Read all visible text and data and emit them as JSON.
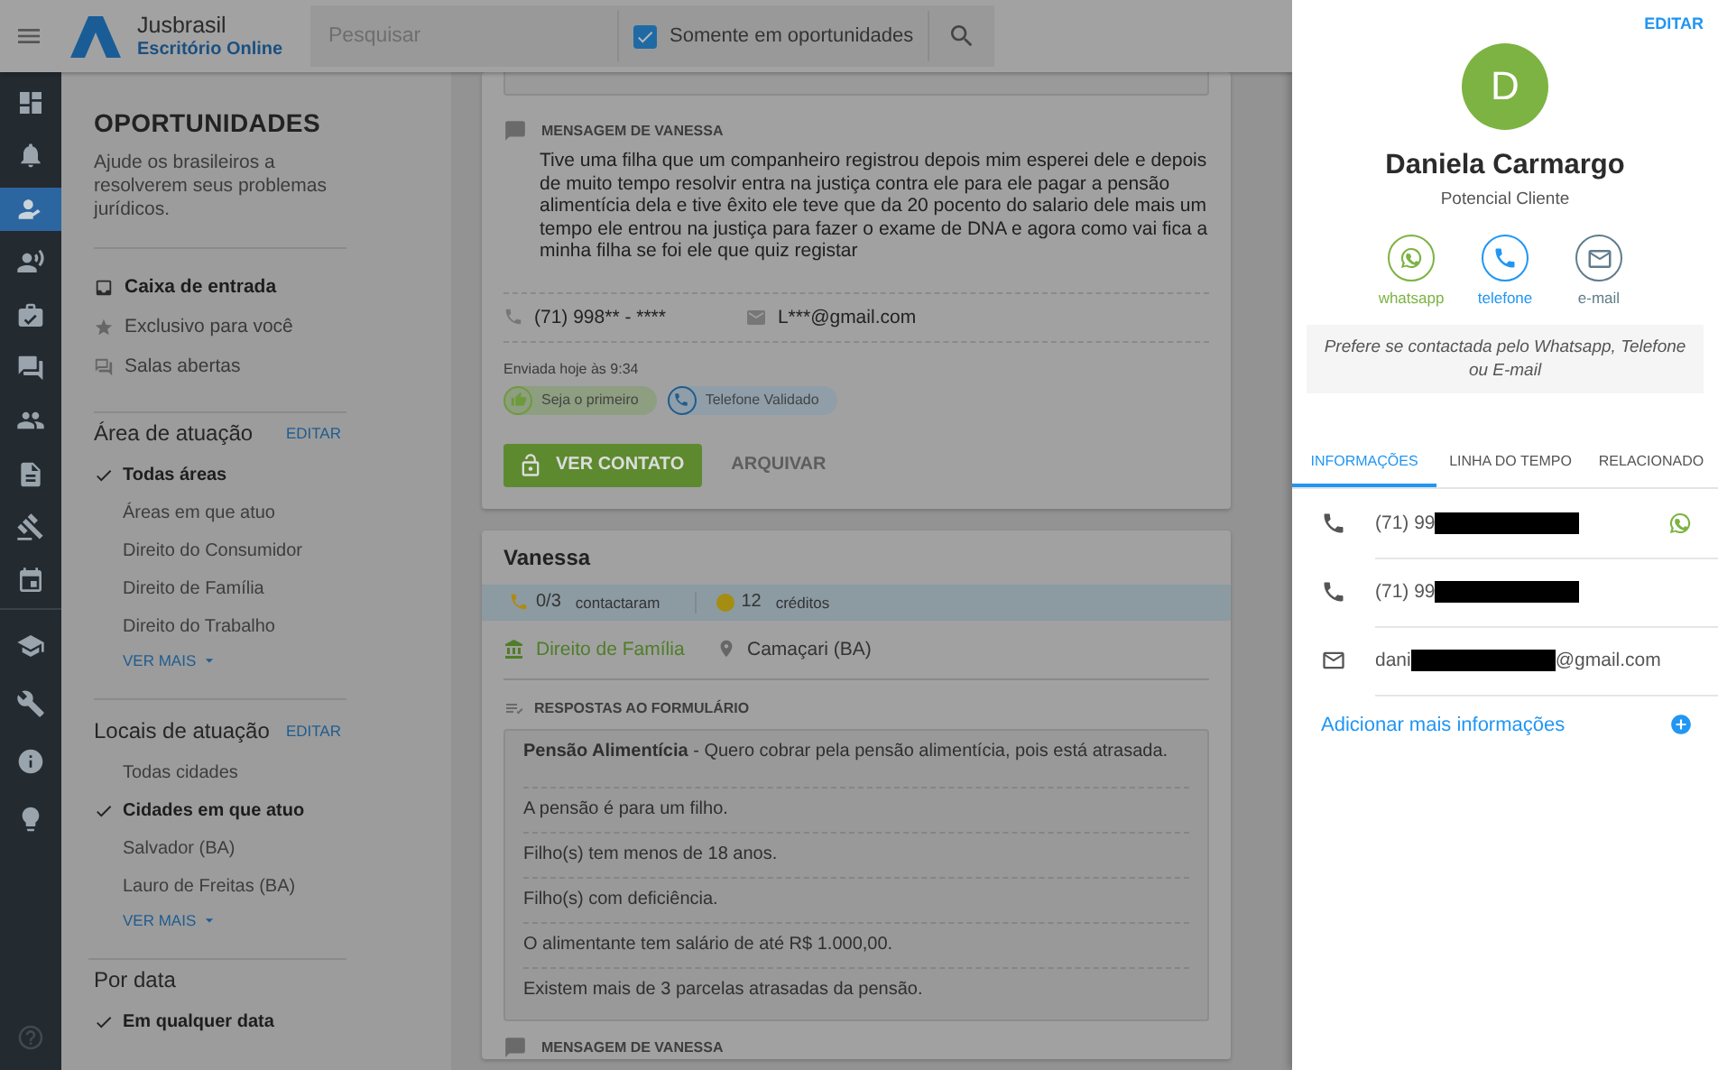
{
  "header": {
    "logo": {
      "name": "Jusbrasil",
      "subtitle": "Escritório Online"
    },
    "search": {
      "placeholder": "Pesquisar"
    },
    "filter": {
      "label": "Somente em oportunidades",
      "checked": true
    }
  },
  "rail": {
    "items": [
      {
        "kind": "dashboard",
        "selected": false
      },
      {
        "kind": "bell",
        "selected": false
      },
      {
        "kind": "person",
        "selected": true
      },
      {
        "kind": "speaker",
        "selected": false
      },
      {
        "kind": "briefcase",
        "selected": false
      },
      {
        "kind": "chat",
        "selected": false
      },
      {
        "kind": "group",
        "selected": false
      },
      {
        "kind": "document",
        "selected": false
      },
      {
        "kind": "gavel",
        "selected": false
      },
      {
        "kind": "calendar",
        "selected": false
      }
    ],
    "bottom_items": [
      {
        "kind": "school",
        "selected": false
      },
      {
        "kind": "wrench",
        "selected": false
      },
      {
        "kind": "info",
        "selected": false
      },
      {
        "kind": "bulb",
        "selected": false
      }
    ]
  },
  "sidebar": {
    "title": "OPORTUNIDADES",
    "description": "Ajude os brasileiros a resolverem seus problemas jurídicos.",
    "nav": [
      {
        "kind": "inbox",
        "label": "Caixa de entrada",
        "selected": true
      },
      {
        "kind": "star",
        "label": "Exclusivo para você",
        "selected": false
      },
      {
        "kind": "rooms",
        "label": "Salas abertas",
        "selected": false
      }
    ],
    "filters": [
      {
        "title": "Área de atuação",
        "edit": "EDITAR",
        "more": "VER MAIS",
        "options": [
          {
            "label": "Todas áreas",
            "checked": true
          },
          {
            "label": "Áreas em que atuo",
            "checked": false
          },
          {
            "label": "Direito do Consumidor",
            "checked": false
          },
          {
            "label": "Direito de Família",
            "checked": false
          },
          {
            "label": "Direito do Trabalho",
            "checked": false
          }
        ]
      },
      {
        "title": "Locais de atuação",
        "edit": "EDITAR",
        "more": "VER MAIS",
        "options": [
          {
            "label": "Todas cidades",
            "checked": false
          },
          {
            "label": "Cidades em que atuo",
            "checked": true
          },
          {
            "label": "Salvador (BA)",
            "checked": false
          },
          {
            "label": "Lauro de Freitas (BA)",
            "checked": false
          }
        ]
      },
      {
        "title": "Por data",
        "options": [
          {
            "label": "Em qualquer data",
            "checked": true
          }
        ]
      }
    ]
  },
  "lead_card": {
    "message_title": "MENSAGEM DE VANESSA",
    "message": "Tive uma filha que um companheiro registrou depois mim esperei dele e depois de muito tempo resolvir entra na justiça contra ele para ele pagar a pensão alimentícia dela e tive êxito ele teve que da 20 pocento do salario dele mais um tempo ele entrou na justiça para fazer o exame de DNA e agora como vai fica a minha filha se foi ele que quiz registar",
    "phone": "(71) 998** - ****",
    "email": "L***@gmail.com",
    "sent": "Enviada hoje às 9:34",
    "badges": [
      {
        "kind": "thumb",
        "label": "Seja o primeiro"
      },
      {
        "kind": "phone",
        "label": "Telefone Validado"
      }
    ],
    "primary_action": "VER CONTATO",
    "secondary_action": "ARQUIVAR"
  },
  "detail_card": {
    "name": "Vanessa",
    "contacted": "0/3",
    "contacted_label": "contactaram",
    "credits": "12",
    "credits_label": "créditos",
    "area": "Direito de Família",
    "location": "Camaçari (BA)",
    "form_title": "RESPOSTAS AO FORMULÁRIO",
    "form_lead": "**Pensão Alimentícia** - Quero cobrar pela pensão alimentícia, pois está atrasada.",
    "answers": [
      "A pensão é para um filho.",
      "Filho(s) tem menos de 18 anos.",
      "Filho(s) com deficiência.",
      "O alimentante tem salário de até R$ 1.000,00.",
      "Existem mais de 3 parcelas atrasadas da pensão."
    ],
    "message_title": "MENSAGEM DE VANESSA"
  },
  "drawer": {
    "edit": "EDITAR",
    "initial": "D",
    "name": "Daniela Carmargo",
    "role": "Potencial Cliente",
    "actions": [
      {
        "kind": "whatsapp",
        "label": "whatsapp",
        "color": "#7cb342"
      },
      {
        "kind": "phone",
        "label": "telefone",
        "color": "#2196f3"
      },
      {
        "kind": "email",
        "label": "e-mail",
        "color": "#607d8b"
      }
    ],
    "preference": "Prefere se contactada pelo Whatsapp, Telefone ou E-mail",
    "tabs": [
      {
        "label": "INFORMAÇÕES",
        "selected": true
      },
      {
        "label": "LINHA DO TEMPO",
        "selected": false
      },
      {
        "label": "RELACIONADO",
        "selected": false
      }
    ],
    "contacts": [
      {
        "kind": "phone",
        "value_start": "(71) 99",
        "redacted": true,
        "whatsapp": true
      },
      {
        "kind": "phone",
        "value_start": "(71) 99",
        "redacted": true,
        "whatsapp": false
      },
      {
        "kind": "email",
        "value_start": "dani",
        "redacted": true,
        "value_end": "@gmail.com",
        "whatsapp": false
      }
    ],
    "add_more": "Adicionar mais informações"
  }
}
